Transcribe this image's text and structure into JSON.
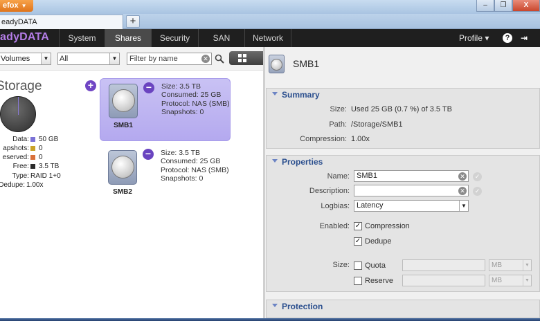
{
  "browser": {
    "menu_label": "efox",
    "tab_title": "eadyDATA",
    "new_tab": "+",
    "minimize": "–",
    "restore": "❐",
    "close": "X"
  },
  "app": {
    "logo": "adyDATA",
    "nav": [
      "System",
      "Shares",
      "Security",
      "SAN",
      "Network"
    ],
    "profile_label": "Profile ▾",
    "help": "?",
    "logout": "⇥"
  },
  "toolbar": {
    "view_select": "Volumes",
    "type_select": "All",
    "filter_placeholder": "Filter by name"
  },
  "storage": {
    "title": "Storage",
    "stats": [
      {
        "label": "Data:",
        "value": "50 GB",
        "color": "#7b72d6"
      },
      {
        "label": "apshots:",
        "value": "0",
        "color": "#c9a227"
      },
      {
        "label": "eserved:",
        "value": "0",
        "color": "#d9703a"
      },
      {
        "label": "Free:",
        "value": "3.5 TB",
        "color": "#2b2b2b"
      },
      {
        "label": "Type:",
        "value": "RAID 1+0"
      },
      {
        "label": "Dedupe:",
        "value": "1.00x"
      }
    ]
  },
  "shares": [
    {
      "name": "SMB1",
      "size": "Size: 3.5 TB",
      "consumed": "Consumed: 25 GB",
      "protocol": "Protocol: NAS (SMB)",
      "snapshots": "Snapshots: 0"
    },
    {
      "name": "SMB2",
      "size": "Size: 3.5 TB",
      "consumed": "Consumed: 25 GB",
      "protocol": "Protocol: NAS (SMB)",
      "snapshots": "Snapshots: 0"
    }
  ],
  "detail": {
    "title": "SMB1",
    "summary": {
      "heading": "Summary",
      "size_label": "Size:",
      "size_value": "Used 25 GB (0.7 %) of 3.5 TB",
      "path_label": "Path:",
      "path_value": "/Storage/SMB1",
      "compression_label": "Compression:",
      "compression_value": "1.00x"
    },
    "properties": {
      "heading": "Properties",
      "name_label": "Name:",
      "name_value": "SMB1",
      "description_label": "Description:",
      "description_value": "",
      "logbias_label": "Logbias:",
      "logbias_value": "Latency",
      "enabled_label": "Enabled:",
      "compression_label": "Compression",
      "dedupe_label": "Dedupe",
      "size_label": "Size:",
      "quota_label": "Quota",
      "reserve_label": "Reserve",
      "unit": "MB"
    },
    "protection": {
      "heading": "Protection"
    }
  }
}
